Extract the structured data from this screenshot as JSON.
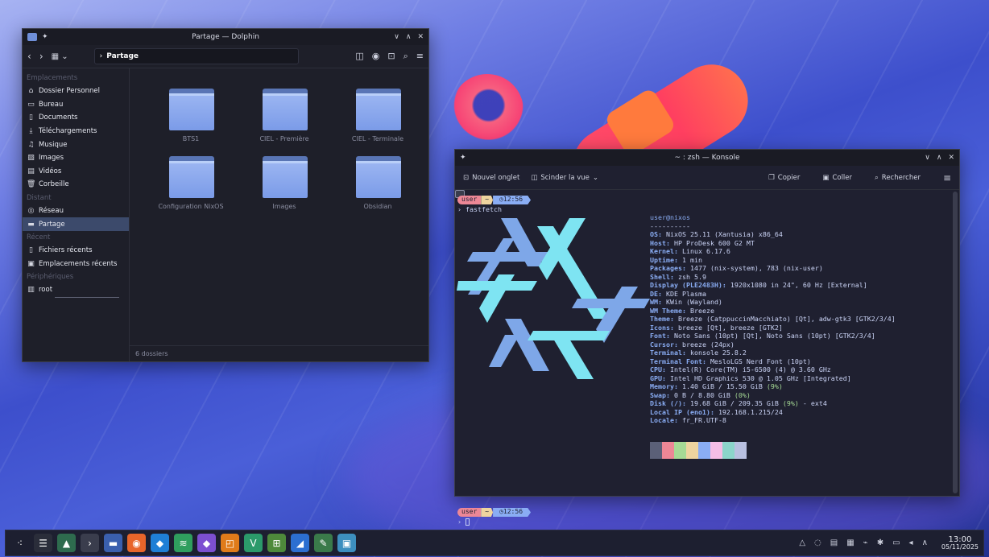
{
  "dolphin": {
    "title": "Partage — Dolphin",
    "window_buttons": [
      "∨",
      "∧",
      "✕"
    ],
    "breadcrumb": "Partage",
    "sidebar": {
      "sections": [
        {
          "label": "Emplacements",
          "items": [
            "Dossier Personnel",
            "Bureau",
            "Documents",
            "Téléchargements",
            "Musique",
            "Images",
            "Vidéos",
            "Corbeille"
          ]
        },
        {
          "label": "Distant",
          "items": [
            "Réseau",
            "Partage"
          ]
        },
        {
          "label": "Récent",
          "items": [
            "Fichiers récents",
            "Emplacements récents"
          ]
        },
        {
          "label": "Périphériques",
          "items": [
            "root"
          ]
        }
      ],
      "selected": "Partage"
    },
    "folders": [
      "BTS1",
      "CIEL - Première",
      "CIEL - Terminale",
      "Configuration NixOS",
      "Images",
      "Obsidian"
    ],
    "status": "6 dossiers"
  },
  "konsole": {
    "title": "~ : zsh — Konsole",
    "window_buttons": [
      "∨",
      "∧",
      "✕"
    ],
    "toolbar": {
      "new_tab": "Nouvel onglet",
      "split": "Scinder la vue",
      "copy": "Copier",
      "paste": "Coller",
      "search": "Rechercher"
    },
    "prompt": {
      "user": "user",
      "dir": "~",
      "time": "12:56"
    },
    "command": "fastfetch",
    "info": {
      "header": "user@nixos",
      "divider": "----------",
      "lines": [
        {
          "k": "OS",
          "v": "NixOS 25.11 (Xantusia) x86_64"
        },
        {
          "k": "Host",
          "v": "HP ProDesk 600 G2 MT"
        },
        {
          "k": "Kernel",
          "v": "Linux 6.17.6"
        },
        {
          "k": "Uptime",
          "v": "1 min"
        },
        {
          "k": "Packages",
          "v": "1477 (nix-system), 783 (nix-user)"
        },
        {
          "k": "Shell",
          "v": "zsh 5.9"
        },
        {
          "k": "Display (PLE2483H)",
          "v": "1920x1080 in 24\", 60 Hz [External]"
        },
        {
          "k": "DE",
          "v": "KDE Plasma"
        },
        {
          "k": "WM",
          "v": "KWin (Wayland)"
        },
        {
          "k": "WM Theme",
          "v": "Breeze"
        },
        {
          "k": "Theme",
          "v": "Breeze (CatppuccinMacchiato) [Qt], adw-gtk3 [GTK2/3/4]"
        },
        {
          "k": "Icons",
          "v": "breeze [Qt], breeze [GTK2]"
        },
        {
          "k": "Font",
          "v": "Noto Sans (10pt) [Qt], Noto Sans (10pt) [GTK2/3/4]"
        },
        {
          "k": "Cursor",
          "v": "breeze (24px)"
        },
        {
          "k": "Terminal",
          "v": "konsole 25.8.2"
        },
        {
          "k": "Terminal Font",
          "v": "MesloLGS Nerd Font (10pt)"
        },
        {
          "k": "CPU",
          "v": "Intel(R) Core(TM) i5-6500 (4) @ 3.60 GHz"
        },
        {
          "k": "GPU",
          "v": "Intel HD Graphics 530 @ 1.05 GHz [Integrated]"
        },
        {
          "k": "Memory",
          "v": "1.40 GiB / 15.50 GiB",
          "pct": "(9%)"
        },
        {
          "k": "Swap",
          "v": "0 B / 8.80 GiB",
          "pct": "(0%)"
        },
        {
          "k": "Disk (/)",
          "v": "19.68 GiB / 209.35 GiB",
          "pct": "(9%)",
          "tail": " - ext4"
        },
        {
          "k": "Local IP (eno1)",
          "v": "192.168.1.215/24"
        },
        {
          "k": "Locale",
          "v": "fr_FR.UTF-8"
        }
      ]
    },
    "palette": [
      "#5b6078",
      "#ed8796",
      "#a6da95",
      "#eed49f",
      "#8aadf4",
      "#f5bde6",
      "#8bd5ca",
      "#b8c0e0"
    ]
  },
  "taskbar": {
    "apps": [
      {
        "name": "app-launcher",
        "color": "#1d1f30",
        "glyph": "⁖"
      },
      {
        "name": "system-monitor",
        "color": "#2a2d3a",
        "glyph": "☰"
      },
      {
        "name": "image-viewer",
        "color": "#2e6b4e",
        "glyph": "▲"
      },
      {
        "name": "konsole",
        "color": "#3a3d4d",
        "glyph": "›"
      },
      {
        "name": "dolphin",
        "color": "#3a5fae",
        "glyph": "▬"
      },
      {
        "name": "firefox",
        "color": "#e8652a",
        "glyph": "◉"
      },
      {
        "name": "browser-blue",
        "color": "#1f7fd6",
        "glyph": "◆"
      },
      {
        "name": "layers-app",
        "color": "#2f9e5e",
        "glyph": "≋"
      },
      {
        "name": "obsidian",
        "color": "#7c4fd1",
        "glyph": "◆"
      },
      {
        "name": "app-orange",
        "color": "#e07b1a",
        "glyph": "◰"
      },
      {
        "name": "vscode-like",
        "color": "#2b9a6a",
        "glyph": "V"
      },
      {
        "name": "network-app",
        "color": "#4e8a3b",
        "glyph": "⊞"
      },
      {
        "name": "wing-app",
        "color": "#2c6fd1",
        "glyph": "◢"
      },
      {
        "name": "paint-app",
        "color": "#3a7a4a",
        "glyph": "✎"
      },
      {
        "name": "screenshot-app",
        "color": "#3d8fbf",
        "glyph": "▣"
      }
    ],
    "tray": [
      "△",
      "◌",
      "▤",
      "▦",
      "⌁",
      "✱",
      "▭",
      "◂",
      "∧"
    ],
    "time": "13:00",
    "date": "05/11/2025"
  }
}
